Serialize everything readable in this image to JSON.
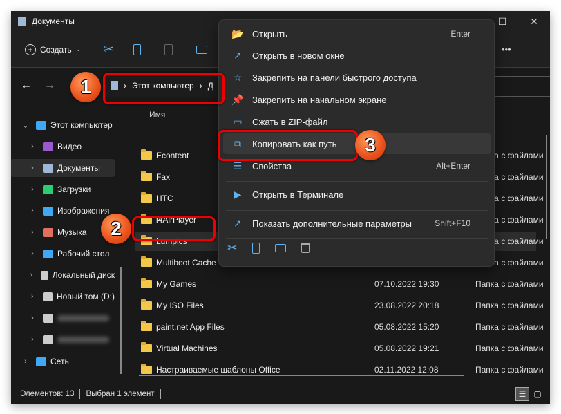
{
  "window": {
    "title": "Документы",
    "minimize": "—",
    "maximize": "☐",
    "close": "✕"
  },
  "toolbar": {
    "create_label": "Создать",
    "more": "•••"
  },
  "address": {
    "path": [
      "Этот компьютер",
      "Д"
    ]
  },
  "sidebar": {
    "items": [
      {
        "label": "Этот компьютер",
        "icon": "computer-icon",
        "color": "#3fa9f5"
      },
      {
        "label": "Видео",
        "icon": "video-icon",
        "color": "#9b59d0"
      },
      {
        "label": "Документы",
        "icon": "documents-icon",
        "color": "#9fb8d6"
      },
      {
        "label": "Загрузки",
        "icon": "download-icon",
        "color": "#2ecc71"
      },
      {
        "label": "Изображения",
        "icon": "pictures-icon",
        "color": "#3fa9f5"
      },
      {
        "label": "Музыка",
        "icon": "music-icon",
        "color": "#e07060"
      },
      {
        "label": "Рабочий стол",
        "icon": "desktop-icon",
        "color": "#3fa9f5"
      },
      {
        "label": "Локальный диск",
        "icon": "drive-icon",
        "color": "#ccc"
      },
      {
        "label": "Новый том (D:)",
        "icon": "drive-icon",
        "color": "#ccc"
      },
      {
        "label": "",
        "icon": "drive-icon",
        "color": "#ccc"
      },
      {
        "label": "",
        "icon": "drive-icon",
        "color": "#ccc"
      },
      {
        "label": "Сеть",
        "icon": "network-icon",
        "color": "#3fa9f5"
      }
    ]
  },
  "list": {
    "header_name": "Имя",
    "rows": [
      {
        "name": "Econtent",
        "date": "",
        "type": "Папка с файлами"
      },
      {
        "name": "Fax",
        "date": "",
        "type": "Папка с файлами"
      },
      {
        "name": "HTC",
        "date": "",
        "type": "Папка с файлами"
      },
      {
        "name": "i4AirPlayer",
        "date": "",
        "type": "Папка с файлами"
      },
      {
        "name": "Lumpics",
        "date": "",
        "type": "Папка с файлами"
      },
      {
        "name": "Multiboot Cache",
        "date": "",
        "type": "Папка с файлами"
      },
      {
        "name": "My Games",
        "date": "07.10.2022 19:30",
        "type": "Папка с файлами"
      },
      {
        "name": "My ISO Files",
        "date": "23.08.2022 20:18",
        "type": "Папка с файлами"
      },
      {
        "name": "paint.net App Files",
        "date": "05.08.2022 15:20",
        "type": "Папка с файлами"
      },
      {
        "name": "Virtual Machines",
        "date": "05.08.2022 19:21",
        "type": "Папка с файлами"
      },
      {
        "name": "Настраиваемые шаблоны Office",
        "date": "02.11.2022 12:08",
        "type": "Папка с файлами"
      }
    ]
  },
  "status": {
    "count": "Элементов: 13",
    "selected": "Выбран 1 элемент"
  },
  "context_menu": {
    "items": [
      {
        "label": "Открыть",
        "shortcut": "Enter"
      },
      {
        "label": "Открыть в новом окне",
        "shortcut": ""
      },
      {
        "label": "Закрепить на панели быстрого доступа",
        "shortcut": ""
      },
      {
        "label": "Закрепить на начальном экране",
        "shortcut": ""
      },
      {
        "label": "Сжать в ZIP-файл",
        "shortcut": ""
      },
      {
        "label": "Копировать как путь",
        "shortcut": ""
      },
      {
        "label": "Свойства",
        "shortcut": "Alt+Enter"
      },
      {
        "label": "Открыть в Терминале",
        "shortcut": ""
      },
      {
        "label": "Показать дополнительные параметры",
        "shortcut": "Shift+F10"
      }
    ]
  },
  "annotations": {
    "step1": "1",
    "step2": "2",
    "step3": "3",
    "highlight_color": "#ee0000"
  }
}
